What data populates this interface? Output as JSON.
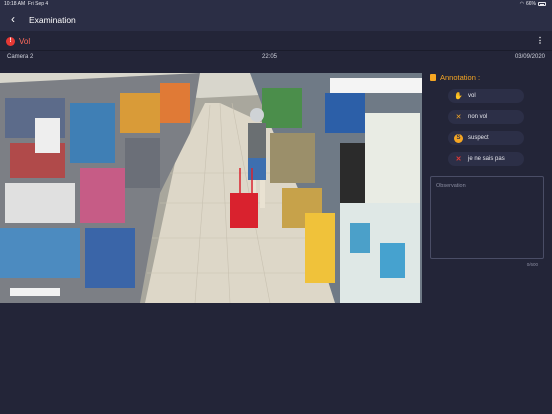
{
  "status_bar": {
    "time": "10:18 AM",
    "date": "Fri Sep 4",
    "battery": "66%"
  },
  "nav": {
    "back_icon": "chevron-left-icon",
    "title": "Examination"
  },
  "alert": {
    "label": "Vol",
    "icon": "!"
  },
  "more_icon": "⋮",
  "info": {
    "camera": "Camera 2",
    "time": "22:05",
    "date": "03/09/2020"
  },
  "annotation": {
    "title": "Annotation :",
    "options": [
      {
        "label": "vol",
        "icon": "✋"
      },
      {
        "label": "non vol",
        "icon": "✕"
      },
      {
        "label": "suspect",
        "icon": "S"
      },
      {
        "label": "je ne sais pas",
        "icon": "✕"
      }
    ]
  },
  "observation": {
    "placeholder": "Observation",
    "counter": "0/600"
  },
  "colors": {
    "accent": "#f5a623",
    "alert": "#e53935",
    "background": "#232538",
    "bar": "#2b2e45"
  }
}
